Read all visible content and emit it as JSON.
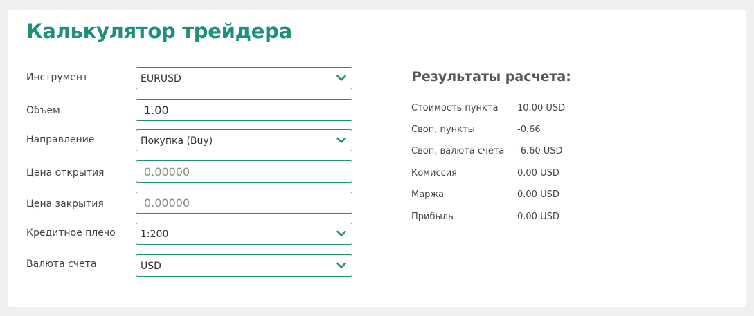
{
  "title": "Калькулятор трейдера",
  "colors": {
    "accent": "#1e8f79",
    "background": "#efefef",
    "card": "#ffffff"
  },
  "form": {
    "instrument": {
      "label": "Инструмент",
      "value": "EURUSD",
      "icon": "chevron-down-icon"
    },
    "volume": {
      "label": "Объем",
      "value": "1.00"
    },
    "direction": {
      "label": "Направление",
      "value": "Покупка (Buy)",
      "icon": "chevron-down-icon"
    },
    "open_price": {
      "label": "Цена открытия",
      "placeholder": "0.00000"
    },
    "close_price": {
      "label": "Цена закрытия",
      "placeholder": "0.00000"
    },
    "leverage": {
      "label": "Кредитное плечо",
      "value": "1:200",
      "icon": "chevron-down-icon"
    },
    "currency": {
      "label": "Валюта счета",
      "value": "USD",
      "icon": "chevron-down-icon"
    }
  },
  "results": {
    "title": "Результаты расчета:",
    "items": [
      {
        "label": "Стоимость пункта",
        "value": "10.00 USD"
      },
      {
        "label": "Своп, пункты",
        "value": "-0.66"
      },
      {
        "label": "Своп, валюта счета",
        "value": "-6.60 USD"
      },
      {
        "label": "Комиссия",
        "value": "0.00 USD"
      },
      {
        "label": "Маржа",
        "value": "0.00 USD"
      },
      {
        "label": "Прибыль",
        "value": "0.00 USD"
      }
    ]
  }
}
